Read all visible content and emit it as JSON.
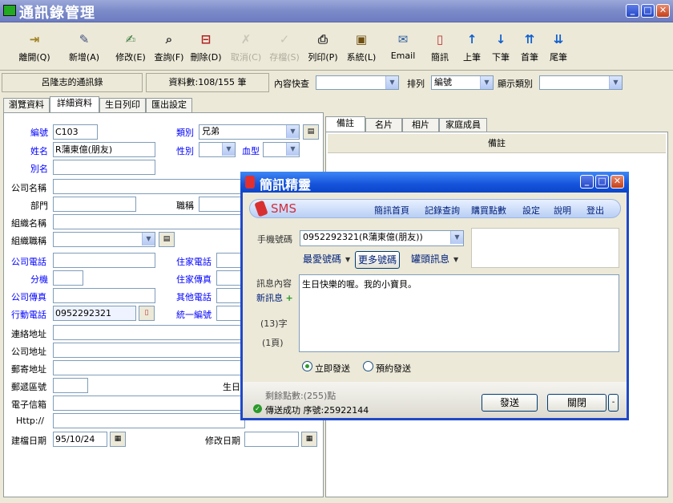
{
  "window": {
    "title": "通訊錄管理",
    "min": "_",
    "max": "□",
    "close": "✕"
  },
  "toolbar": [
    {
      "label": "離開(Q)",
      "icon": "exit-door-icon",
      "glyph": "⇥",
      "color": "#a08020",
      "enabled": true
    },
    {
      "label": "新增(A)",
      "icon": "new-icon",
      "glyph": "✎",
      "color": "#405080",
      "enabled": true
    },
    {
      "label": "修改(E)",
      "icon": "edit-icon",
      "glyph": "✍",
      "color": "#3a7a3a",
      "enabled": true
    },
    {
      "label": "查詢(F)",
      "icon": "search-icon",
      "glyph": "⌕",
      "color": "#303030",
      "enabled": true
    },
    {
      "label": "刪除(D)",
      "icon": "delete-icon",
      "glyph": "⊟",
      "color": "#b02020",
      "enabled": true
    },
    {
      "label": "取消(C)",
      "icon": "cancel-icon",
      "glyph": "✗",
      "color": "#c8c5b8",
      "enabled": false
    },
    {
      "label": "存檔(S)",
      "icon": "save-icon",
      "glyph": "✓",
      "color": "#c8c5b8",
      "enabled": false
    },
    {
      "label": "列印(P)",
      "icon": "printer-icon",
      "glyph": "⎙",
      "color": "#303030",
      "enabled": true
    },
    {
      "label": "系統(L)",
      "icon": "system-disk-icon",
      "glyph": "▣",
      "color": "#705010",
      "enabled": true
    },
    {
      "label": "Email",
      "icon": "email-icon",
      "glyph": "✉",
      "color": "#3060a0",
      "enabled": true
    },
    {
      "label": "簡訊",
      "icon": "mobile-phone-icon",
      "glyph": "▯",
      "color": "#c03030",
      "enabled": true
    },
    {
      "label": "上筆",
      "icon": "arrow-up-icon",
      "glyph": "↑",
      "color": "#1060d0",
      "enabled": true
    },
    {
      "label": "下筆",
      "icon": "arrow-down-icon",
      "glyph": "↓",
      "color": "#1060d0",
      "enabled": true
    },
    {
      "label": "首筆",
      "icon": "first-record-icon",
      "glyph": "⇈",
      "color": "#1060d0",
      "enabled": true
    },
    {
      "label": "尾筆",
      "icon": "last-record-icon",
      "glyph": "⇊",
      "color": "#1060d0",
      "enabled": true
    }
  ],
  "infobar": {
    "owner": "呂隆志的通訊錄",
    "count": "資料數:108/155 筆",
    "quick_search_label": "內容快查",
    "quick_search_value": "",
    "sort_label": "排列",
    "sort_value": "編號",
    "category_label": "顯示類別",
    "category_value": ""
  },
  "tabs": [
    "瀏覽資料",
    "詳細資料",
    "生日列印",
    "匯出設定"
  ],
  "form": {
    "id_label": "編號",
    "id_value": "C103",
    "name_label": "姓名",
    "name_value": "R蒲東億(朋友)",
    "alias_label": "別名",
    "alias_value": "",
    "company_label": "公司名稱",
    "dept_label": "部門",
    "title_label": "職稱",
    "org_label": "組織名稱",
    "org_title_label": "組織職稱",
    "category_label": "類別",
    "category_value": "兄弟",
    "gender_label": "性別",
    "blood_label": "血型",
    "office_phone_label": "公司電話",
    "ext_label": "分機",
    "office_fax_label": "公司傳真",
    "mobile_label": "行動電話",
    "mobile_value": "0952292321",
    "home_phone_label": "住家電話",
    "home_fax_label": "住家傳真",
    "other_phone_label": "其他電話",
    "tax_id_label": "統一編號",
    "address_label": "連絡地址",
    "company_addr_label": "公司地址",
    "mail_addr_label": "郵寄地址",
    "zip_label": "郵遞區號",
    "birthday_label": "生日",
    "email_label": "電子信箱",
    "http_label": "Http://",
    "created_label": "建檔日期",
    "created_value": "95/10/24",
    "modified_label": "修改日期",
    "modified_value": ""
  },
  "right_tabs": [
    "備註",
    "名片",
    "相片",
    "家庭成員"
  ],
  "notes_header": "備註",
  "sms": {
    "title": "簡訊精靈",
    "brand": "SMS",
    "nav": [
      "簡訊首頁",
      "記錄查詢",
      "購買點數",
      "設定",
      "說明",
      "登出"
    ],
    "phone_label": "手機號碼",
    "phone_value": "0952292321(R蒲東億(朋友))",
    "fav_label": "最愛號碼",
    "more_label": "更多號碼",
    "canned_label": "罐頭訊息",
    "content_label": "訊息內容",
    "new_msg_label": "新訊息",
    "new_msg_plus": "+",
    "message": "生日快樂的喔。我的小寶貝。",
    "char_count": "(13)字",
    "page_count": "(1頁)",
    "send_now": "立即發送",
    "schedule": "預約發送",
    "balance": "剩餘點數:(255)點",
    "status": "傳送成功 序號:25922144",
    "send_btn": "發送",
    "close_btn": "關閉",
    "more_btn": "-"
  }
}
